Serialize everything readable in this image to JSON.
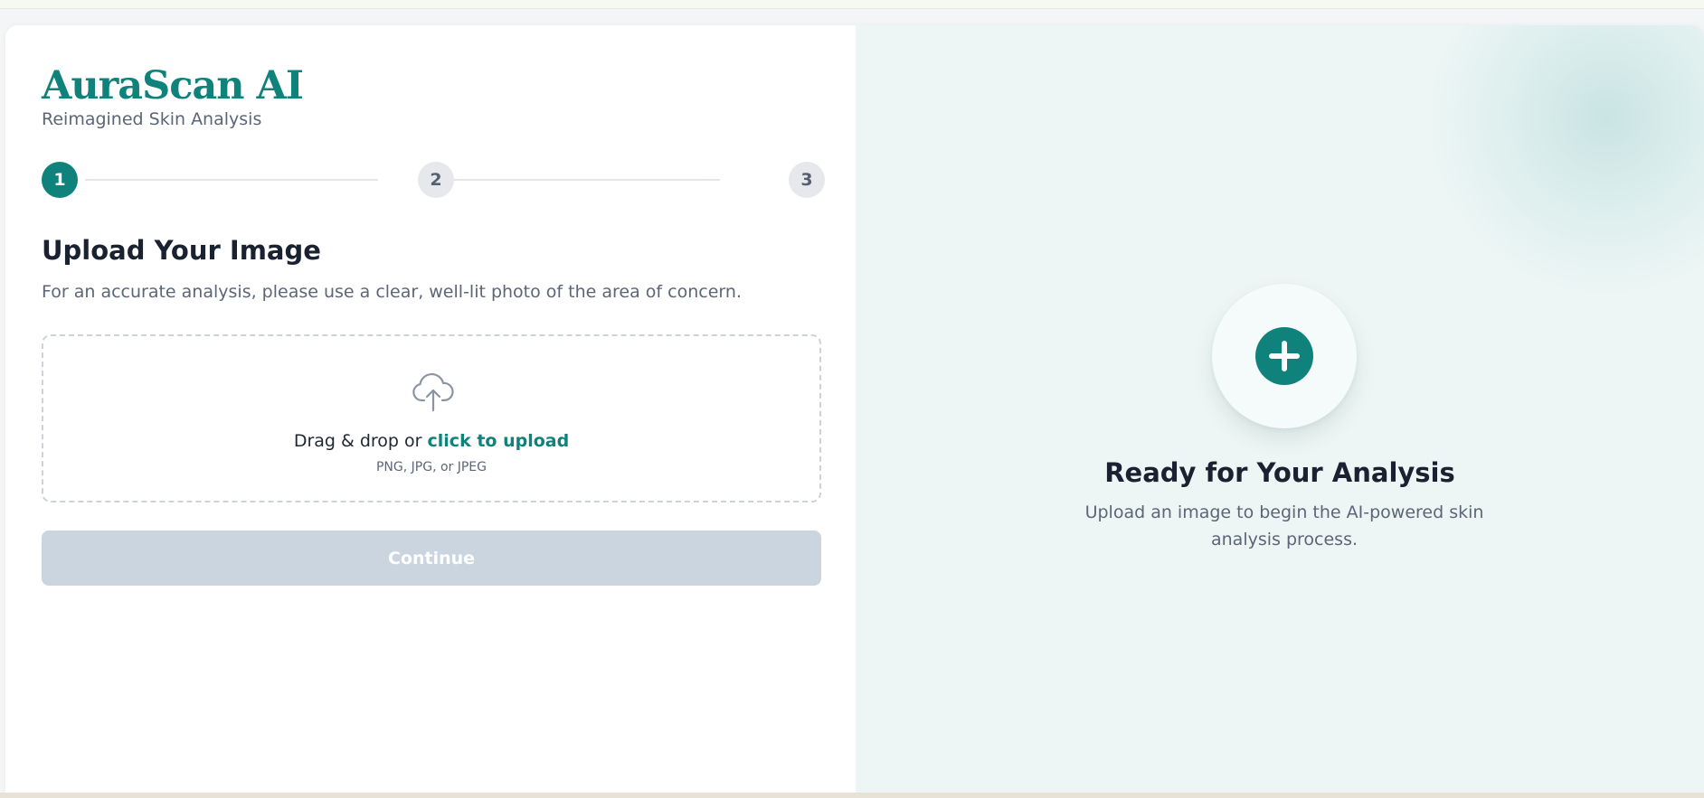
{
  "brand": {
    "name": "AuraScan AI",
    "tagline": "Reimagined Skin Analysis"
  },
  "stepper": {
    "current_step": 1,
    "steps": [
      {
        "label": "1",
        "state": "active"
      },
      {
        "label": "2",
        "state": "inactive"
      },
      {
        "label": "3",
        "state": "inactive"
      }
    ]
  },
  "upload": {
    "title": "Upload Your Image",
    "description": "For an accurate analysis, please use a clear, well-lit photo of the area of concern.",
    "dropzone_prefix": "Drag & drop or ",
    "dropzone_link": "click to upload",
    "accepted_formats": "PNG, JPG, or JPEG",
    "icon": "cloud-upload-icon"
  },
  "continue_button": {
    "label": "Continue",
    "disabled": true
  },
  "preview": {
    "title": "Ready for Your Analysis",
    "description": "Upload an image to begin the AI-powered skin analysis process.",
    "icon": "plus-circle-icon"
  },
  "colors": {
    "accent": "#0f827b",
    "panel_bg": "#edf6f5",
    "disabled_button": "#cbd5e0",
    "text_primary": "#1a2231",
    "text_secondary": "#5b6677"
  }
}
